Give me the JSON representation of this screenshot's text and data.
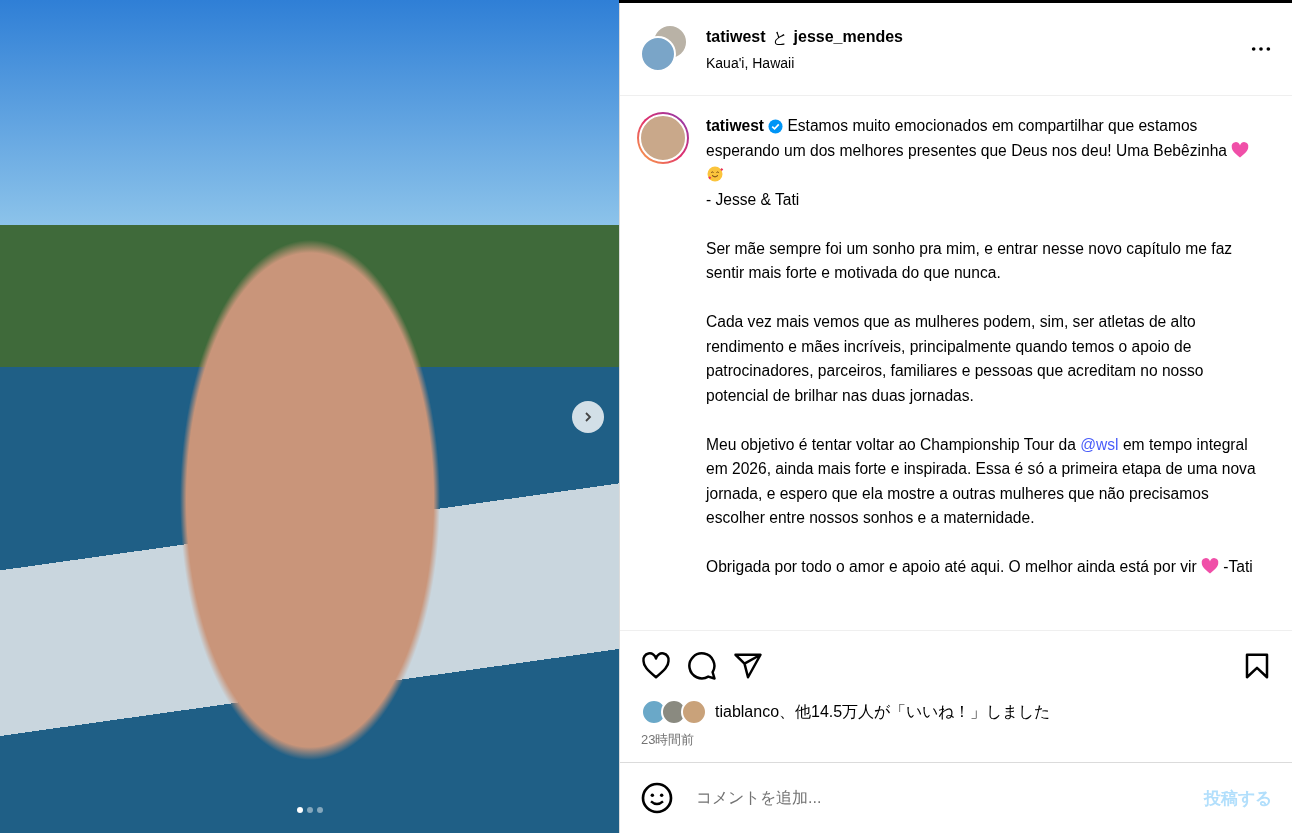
{
  "photo": {
    "dots": [
      {
        "selected": true
      },
      {
        "selected": false
      },
      {
        "selected": false
      }
    ]
  },
  "header": {
    "username": "tatiwest",
    "joiner": "と",
    "coauthor": "jesse_mendes",
    "location": "Kaua'i, Hawaii"
  },
  "caption": {
    "username": "tatiwest",
    "verified": true,
    "paragraphs": [
      [
        {
          "kind": "text",
          "text": "Estamos muito emocionados em compartilhar que estamos esperando um dos melhores presentes que Deus nos deu! Uma Bebêzinha"
        },
        {
          "kind": "heart"
        },
        {
          "kind": "emoji"
        },
        {
          "kind": "break"
        },
        {
          "kind": "text",
          "text": "- Jesse & Tati"
        }
      ],
      [
        {
          "kind": "text",
          "text": "Ser mãe sempre foi um sonho pra mim, e entrar nesse novo capítulo me faz sentir mais forte e motivada do que nunca."
        }
      ],
      [
        {
          "kind": "text",
          "text": "Cada vez mais vemos que as mulheres podem, sim, ser atletas de alto rendimento e mães incríveis, principalmente quando temos o apoio de patrocinadores, parceiros, familiares e pessoas que acreditam no nosso potencial de brilhar nas duas jornadas."
        }
      ],
      [
        {
          "kind": "text",
          "text": "Meu objetivo é tentar voltar ao Championship Tour da"
        },
        {
          "kind": "mention",
          "text": "@wsl"
        },
        {
          "kind": "text",
          "text": "em tempo integral em 2026, ainda mais forte e inspirada. Essa é só a primeira etapa de uma nova jornada, e espero que ela mostre a outras mulheres que não precisamos escolher entre nossos sonhos e a maternidade."
        }
      ],
      [
        {
          "kind": "text",
          "text": "Obrigada por todo o amor e apoio até aqui. O melhor ainda está por vir"
        },
        {
          "kind": "heart"
        },
        {
          "kind": "text",
          "text": "-Tati"
        }
      ]
    ]
  },
  "actions": {
    "liked": false,
    "saved": false
  },
  "likes": {
    "text": "tiablanco、他14.5万人が「いいね！」しました"
  },
  "time": "23時間前",
  "comment": {
    "placeholder": "コメントを追加...",
    "post": "投稿する"
  }
}
